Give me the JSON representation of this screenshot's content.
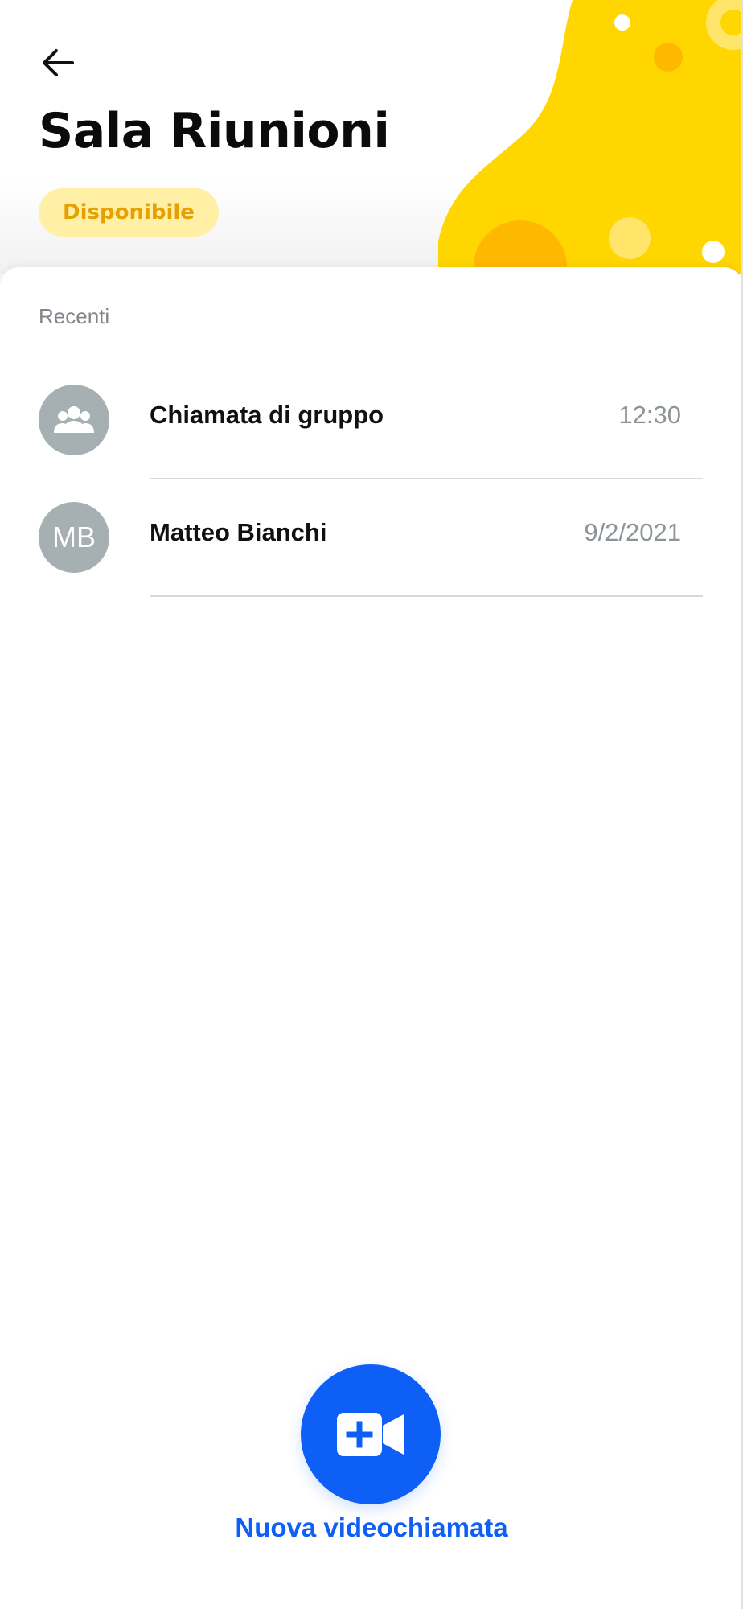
{
  "header": {
    "title": "Sala Riunioni",
    "status": "Disponibile",
    "back_icon": "back-arrow-icon",
    "decor_colors": {
      "primary_yellow": "#FFD600",
      "orange": "#FFB800",
      "light_yellow": "#FFE66B",
      "white": "#FFFFFF"
    }
  },
  "recent": {
    "section_title": "Recenti",
    "items": [
      {
        "name": "Chiamata di gruppo",
        "time": "12:30",
        "avatar": {
          "type": "icon",
          "icon": "group-icon",
          "color": "#A6AFB1"
        }
      },
      {
        "name": "Matteo Bianchi",
        "time": "9/2/2021",
        "avatar": {
          "type": "initials",
          "initials": "MB",
          "color": "#A6AFB1"
        }
      }
    ]
  },
  "actions": {
    "new_video_call": {
      "label": "Nuova videochiamata",
      "icon": "add-video-icon",
      "color": "#0D5FF5"
    }
  }
}
